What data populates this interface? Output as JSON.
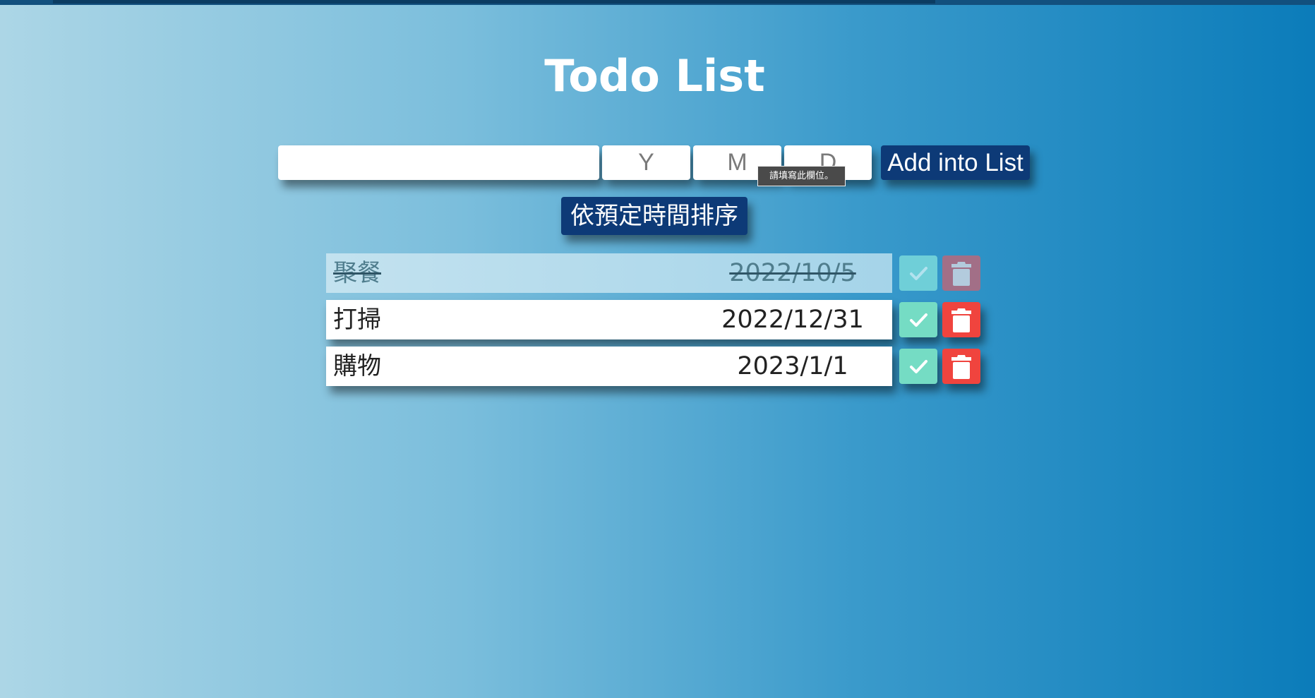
{
  "app": {
    "title": "Todo List"
  },
  "form": {
    "text_placeholder": "",
    "year_placeholder": "Y",
    "month_placeholder": "M",
    "day_placeholder": "D",
    "add_label": "Add into List",
    "tooltip": "請填寫此欄位。"
  },
  "sort": {
    "label": "依預定時間排序"
  },
  "todos": [
    {
      "text": "聚餐",
      "date": "2022/10/5",
      "done": true
    },
    {
      "text": "打掃",
      "date": "2022/12/31",
      "done": false
    },
    {
      "text": "購物",
      "date": "2023/1/1",
      "done": false
    }
  ],
  "colors": {
    "accent_navy": "#0d3a77",
    "check_green": "#75dcc4",
    "delete_red": "#f0443e"
  },
  "icons": {
    "check": "check-icon",
    "delete": "trash-icon"
  }
}
